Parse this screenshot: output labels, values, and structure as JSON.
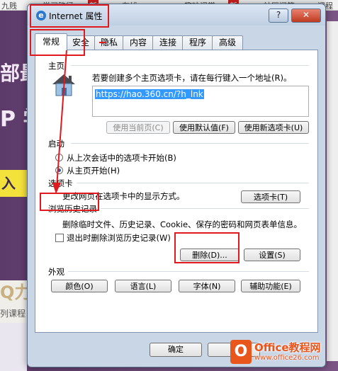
{
  "background": {
    "top_items": [
      "九贱",
      "学习路径",
      "新",
      "在线",
      "趣味课堂",
      "新",
      "社区问答",
      "课程"
    ],
    "left_texts": [
      "部最",
      "P 学",
      "入",
      "Q力",
      "列课程"
    ]
  },
  "dialog": {
    "title": "Internet 属性",
    "help_label": "?",
    "close_label": "✕",
    "tabs": [
      "常规",
      "安全",
      "隐私",
      "内容",
      "连接",
      "程序",
      "高级"
    ],
    "home": {
      "label": "主页",
      "instruction": "若要创建多个主页选项卡，请在每行键入一个地址(R)。",
      "url": "https://hao.360.cn/?h_lnk",
      "use_current": "使用当前页(C)",
      "use_default": "使用默认值(F)",
      "use_new_tab": "使用新选项卡(U)"
    },
    "startup": {
      "label": "启动",
      "option_last_session": "从上次会话中的选项卡开始(B)",
      "option_home": "从主页开始(H)"
    },
    "tabs_group": {
      "label": "选项卡",
      "description": "更改网页在选项卡中的显示方式。",
      "button": "选项卡(T)"
    },
    "history": {
      "label": "浏览历史记录",
      "description": "删除临时文件、历史记录、Cookie、保存的密码和网页表单信息。",
      "delete_on_exit": "退出时删除浏览历史记录(W)",
      "delete_button": "删除(D)...",
      "settings_button": "设置(S)"
    },
    "appearance": {
      "label": "外观",
      "colors": "颜色(O)",
      "languages": "语言(L)",
      "fonts": "字体(N)",
      "accessibility": "辅助功能(E)"
    },
    "ok_button": "确定"
  },
  "watermark": {
    "logo_letter": "O",
    "title": "Office教程网",
    "subtitle": "www.office26.com"
  },
  "colors": {
    "annotation": "#e0191e",
    "selection": "#3399ff"
  }
}
